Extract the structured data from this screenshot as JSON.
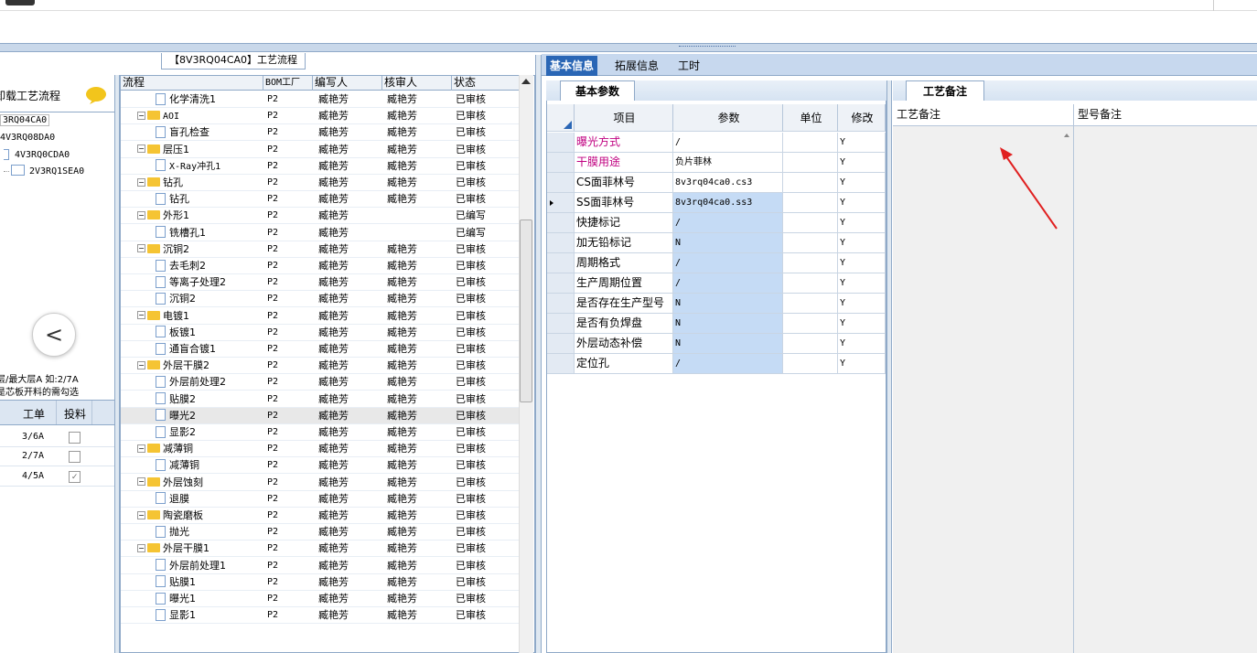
{
  "left_panel": {
    "title": "卸载工艺流程",
    "items": [
      "3RQ04CA0",
      "4V3RQ08DA0",
      "4V3RQ0CDA0",
      "2V3RQ1SEA0"
    ],
    "note_line1": "层/最大层A 如:2/7A",
    "note_line2": "是芯板开料的需勾选",
    "grid_headers": [
      "工单",
      "投料"
    ],
    "grid_rows": [
      {
        "order": "3/6A",
        "checked": false
      },
      {
        "order": "2/7A",
        "checked": false
      },
      {
        "order": "4/5A",
        "checked": true
      }
    ],
    "back_glyph": "<",
    "chat_icon": "speech-bubble-icon"
  },
  "flow": {
    "caption": "【8V3RQ04CA0】工艺流程",
    "headers": [
      "流程",
      "BOM工厂",
      "编写人",
      "核审人",
      "状态"
    ],
    "rows": [
      {
        "name": "化学清洗1",
        "kind": "doc",
        "bom": "P2",
        "writer": "臧艳芳",
        "reviewer": "臧艳芳",
        "status": "已审核"
      },
      {
        "name": "AOI",
        "kind": "folder",
        "bom": "P2",
        "writer": "臧艳芳",
        "reviewer": "臧艳芳",
        "status": "已审核"
      },
      {
        "name": "盲孔检查",
        "kind": "doc",
        "bom": "P2",
        "writer": "臧艳芳",
        "reviewer": "臧艳芳",
        "status": "已审核"
      },
      {
        "name": "层压1",
        "kind": "folder",
        "bom": "P2",
        "writer": "臧艳芳",
        "reviewer": "臧艳芳",
        "status": "已审核"
      },
      {
        "name": "X-Ray冲孔1",
        "kind": "doc",
        "bom": "P2",
        "writer": "臧艳芳",
        "reviewer": "臧艳芳",
        "status": "已审核"
      },
      {
        "name": "钻孔",
        "kind": "folder",
        "bom": "P2",
        "writer": "臧艳芳",
        "reviewer": "臧艳芳",
        "status": "已审核"
      },
      {
        "name": "钻孔",
        "kind": "doc",
        "bom": "P2",
        "writer": "臧艳芳",
        "reviewer": "臧艳芳",
        "status": "已审核"
      },
      {
        "name": "外形1",
        "kind": "folder",
        "bom": "P2",
        "writer": "臧艳芳",
        "reviewer": "",
        "status": "已编写"
      },
      {
        "name": "铣槽孔1",
        "kind": "doc",
        "bom": "P2",
        "writer": "臧艳芳",
        "reviewer": "",
        "status": "已编写"
      },
      {
        "name": "沉铜2",
        "kind": "folder",
        "bom": "P2",
        "writer": "臧艳芳",
        "reviewer": "臧艳芳",
        "status": "已审核"
      },
      {
        "name": "去毛刺2",
        "kind": "doc",
        "bom": "P2",
        "writer": "臧艳芳",
        "reviewer": "臧艳芳",
        "status": "已审核"
      },
      {
        "name": "等离子处理2",
        "kind": "doc",
        "bom": "P2",
        "writer": "臧艳芳",
        "reviewer": "臧艳芳",
        "status": "已审核"
      },
      {
        "name": "沉铜2",
        "kind": "doc",
        "bom": "P2",
        "writer": "臧艳芳",
        "reviewer": "臧艳芳",
        "status": "已审核"
      },
      {
        "name": "电镀1",
        "kind": "folder",
        "bom": "P2",
        "writer": "臧艳芳",
        "reviewer": "臧艳芳",
        "status": "已审核"
      },
      {
        "name": "板镀1",
        "kind": "doc",
        "bom": "P2",
        "writer": "臧艳芳",
        "reviewer": "臧艳芳",
        "status": "已审核"
      },
      {
        "name": "通盲合镀1",
        "kind": "doc",
        "bom": "P2",
        "writer": "臧艳芳",
        "reviewer": "臧艳芳",
        "status": "已审核"
      },
      {
        "name": "外层干膜2",
        "kind": "folder",
        "bom": "P2",
        "writer": "臧艳芳",
        "reviewer": "臧艳芳",
        "status": "已审核"
      },
      {
        "name": "外层前处理2",
        "kind": "doc",
        "bom": "P2",
        "writer": "臧艳芳",
        "reviewer": "臧艳芳",
        "status": "已审核"
      },
      {
        "name": "贴膜2",
        "kind": "doc",
        "bom": "P2",
        "writer": "臧艳芳",
        "reviewer": "臧艳芳",
        "status": "已审核"
      },
      {
        "name": "曝光2",
        "kind": "doc",
        "bom": "P2",
        "writer": "臧艳芳",
        "reviewer": "臧艳芳",
        "status": "已审核",
        "selected": true
      },
      {
        "name": "显影2",
        "kind": "doc",
        "bom": "P2",
        "writer": "臧艳芳",
        "reviewer": "臧艳芳",
        "status": "已审核"
      },
      {
        "name": "减薄铜",
        "kind": "folder",
        "bom": "P2",
        "writer": "臧艳芳",
        "reviewer": "臧艳芳",
        "status": "已审核"
      },
      {
        "name": "减薄铜",
        "kind": "doc",
        "bom": "P2",
        "writer": "臧艳芳",
        "reviewer": "臧艳芳",
        "status": "已审核"
      },
      {
        "name": "外层蚀刻",
        "kind": "folder",
        "bom": "P2",
        "writer": "臧艳芳",
        "reviewer": "臧艳芳",
        "status": "已审核"
      },
      {
        "name": "退膜",
        "kind": "doc",
        "bom": "P2",
        "writer": "臧艳芳",
        "reviewer": "臧艳芳",
        "status": "已审核"
      },
      {
        "name": "陶瓷磨板",
        "kind": "folder",
        "bom": "P2",
        "writer": "臧艳芳",
        "reviewer": "臧艳芳",
        "status": "已审核"
      },
      {
        "name": "抛光",
        "kind": "doc",
        "bom": "P2",
        "writer": "臧艳芳",
        "reviewer": "臧艳芳",
        "status": "已审核"
      },
      {
        "name": "外层干膜1",
        "kind": "folder",
        "bom": "P2",
        "writer": "臧艳芳",
        "reviewer": "臧艳芳",
        "status": "已审核"
      },
      {
        "name": "外层前处理1",
        "kind": "doc",
        "bom": "P2",
        "writer": "臧艳芳",
        "reviewer": "臧艳芳",
        "status": "已审核"
      },
      {
        "name": "贴膜1",
        "kind": "doc",
        "bom": "P2",
        "writer": "臧艳芳",
        "reviewer": "臧艳芳",
        "status": "已审核"
      },
      {
        "name": "曝光1",
        "kind": "doc",
        "bom": "P2",
        "writer": "臧艳芳",
        "reviewer": "臧艳芳",
        "status": "已审核"
      },
      {
        "name": "显影1",
        "kind": "doc",
        "bom": "P2",
        "writer": "臧艳芳",
        "reviewer": "臧艳芳",
        "status": "已审核"
      }
    ]
  },
  "tabs": [
    "基本信息",
    "拓展信息",
    "工时"
  ],
  "params": {
    "tab_label": "基本参数",
    "headers": [
      "项目",
      "参数",
      "单位",
      "修改"
    ],
    "rows": [
      {
        "item": "曝光方式",
        "value": "/",
        "unit": "",
        "edit": "Y",
        "highlight": true,
        "value_blue": false
      },
      {
        "item": "干膜用途",
        "value": "负片菲林",
        "unit": "",
        "edit": "Y",
        "highlight": true,
        "value_blue": false
      },
      {
        "item": "CS面菲林号",
        "value": "8v3rq04ca0.cs3",
        "unit": "",
        "edit": "Y",
        "highlight": false,
        "value_blue": false
      },
      {
        "item": "SS面菲林号",
        "value": "8v3rq04ca0.ss3",
        "unit": "",
        "edit": "Y",
        "highlight": false,
        "value_blue": true,
        "current": true
      },
      {
        "item": "快捷标记",
        "value": "/",
        "unit": "",
        "edit": "Y",
        "highlight": false,
        "value_blue": true
      },
      {
        "item": "加无铅标记",
        "value": "N",
        "unit": "",
        "edit": "Y",
        "highlight": false,
        "value_blue": true
      },
      {
        "item": "周期格式",
        "value": "/",
        "unit": "",
        "edit": "Y",
        "highlight": false,
        "value_blue": true
      },
      {
        "item": "生产周期位置",
        "value": "/",
        "unit": "",
        "edit": "Y",
        "highlight": false,
        "value_blue": true
      },
      {
        "item": "是否存在生产型号",
        "value": "N",
        "unit": "",
        "edit": "Y",
        "highlight": false,
        "value_blue": true
      },
      {
        "item": "是否有负焊盘",
        "value": "N",
        "unit": "",
        "edit": "Y",
        "highlight": false,
        "value_blue": true
      },
      {
        "item": "外层动态补偿",
        "value": "N",
        "unit": "",
        "edit": "Y",
        "highlight": false,
        "value_blue": true
      },
      {
        "item": "定位孔",
        "value": "/",
        "unit": "",
        "edit": "Y",
        "highlight": false,
        "value_blue": true
      }
    ]
  },
  "notes": {
    "tab_label": "工艺备注",
    "col_process_note": "工艺备注",
    "col_model_note": "型号备注"
  },
  "colors": {
    "accent": "#2a66b5",
    "annotation_arrow": "#e02020",
    "highlight_text": "#c00080",
    "value_blue": "#c5dbf5"
  }
}
